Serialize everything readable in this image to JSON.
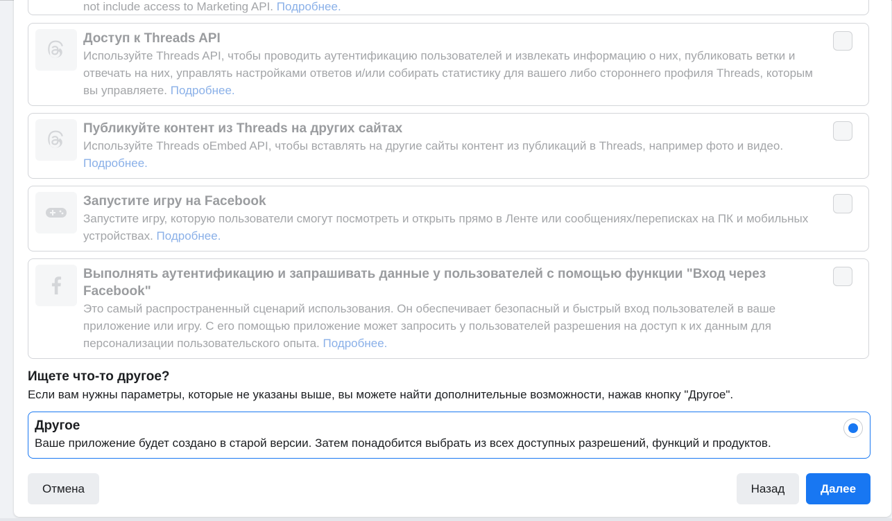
{
  "truncated_card": {
    "text": "not include access to Marketing API.",
    "link": "Подробнее."
  },
  "cards": [
    {
      "icon": "threads-icon",
      "title": "Доступ к Threads API",
      "desc_lines": [
        "Используйте Threads API, чтобы проводить аутентификацию пользователей и извлекать информацию о них, публиковать ветки и",
        "отвечать на них, управлять настройками ответов и/или собирать статистику для вашего либо стороннего профиля Threads, которым",
        "вы управляете."
      ],
      "link": "Подробнее."
    },
    {
      "icon": "threads-icon",
      "title": "Публикуйте контент из Threads на других сайтах",
      "desc_lines": [
        "Используйте Threads oEmbed API, чтобы вставлять на другие сайты контент из публикаций в Threads, например фото и видео."
      ],
      "link": "Подробнее."
    },
    {
      "icon": "gamepad-icon",
      "title": "Запустите игру на Facebook",
      "desc_lines": [
        "Запустите игру, которую пользователи смогут посмотреть и открыть прямо в Ленте или сообщениях/переписках на ПК и мобильных",
        "устройствах."
      ],
      "link": "Подробнее."
    },
    {
      "icon": "facebook-icon",
      "title_lines": [
        "Выполнять аутентификацию и запрашивать данные у пользователей с помощью функции \"Вход через",
        "Facebook\""
      ],
      "desc_lines": [
        "Это самый распространенный сценарий использования. Он обеспечивает безопасный и быстрый вход пользователей в ваше",
        "приложение или игру. С его помощью приложение может запросить у пользователей разрешения на доступ к их данным для",
        "персонализации пользовательского опыта."
      ],
      "link": "Подробнее."
    }
  ],
  "other_section": {
    "title": "Ищете что-то другое?",
    "subtitle": "Если вам нужны параметры, которые не указаны выше, вы можете найти дополнительные возможности, нажав кнопку \"Другое\".",
    "option_title": "Другое",
    "option_desc": "Ваше приложение будет создано в старой версии. Затем понадобится выбрать из всех доступных разрешений, функций и продуктов.",
    "selected": true
  },
  "buttons": {
    "cancel": "Отмена",
    "back": "Назад",
    "next": "Далее"
  },
  "colors": {
    "accent": "#1877f2",
    "link_disabled": "#8ab0e8"
  }
}
